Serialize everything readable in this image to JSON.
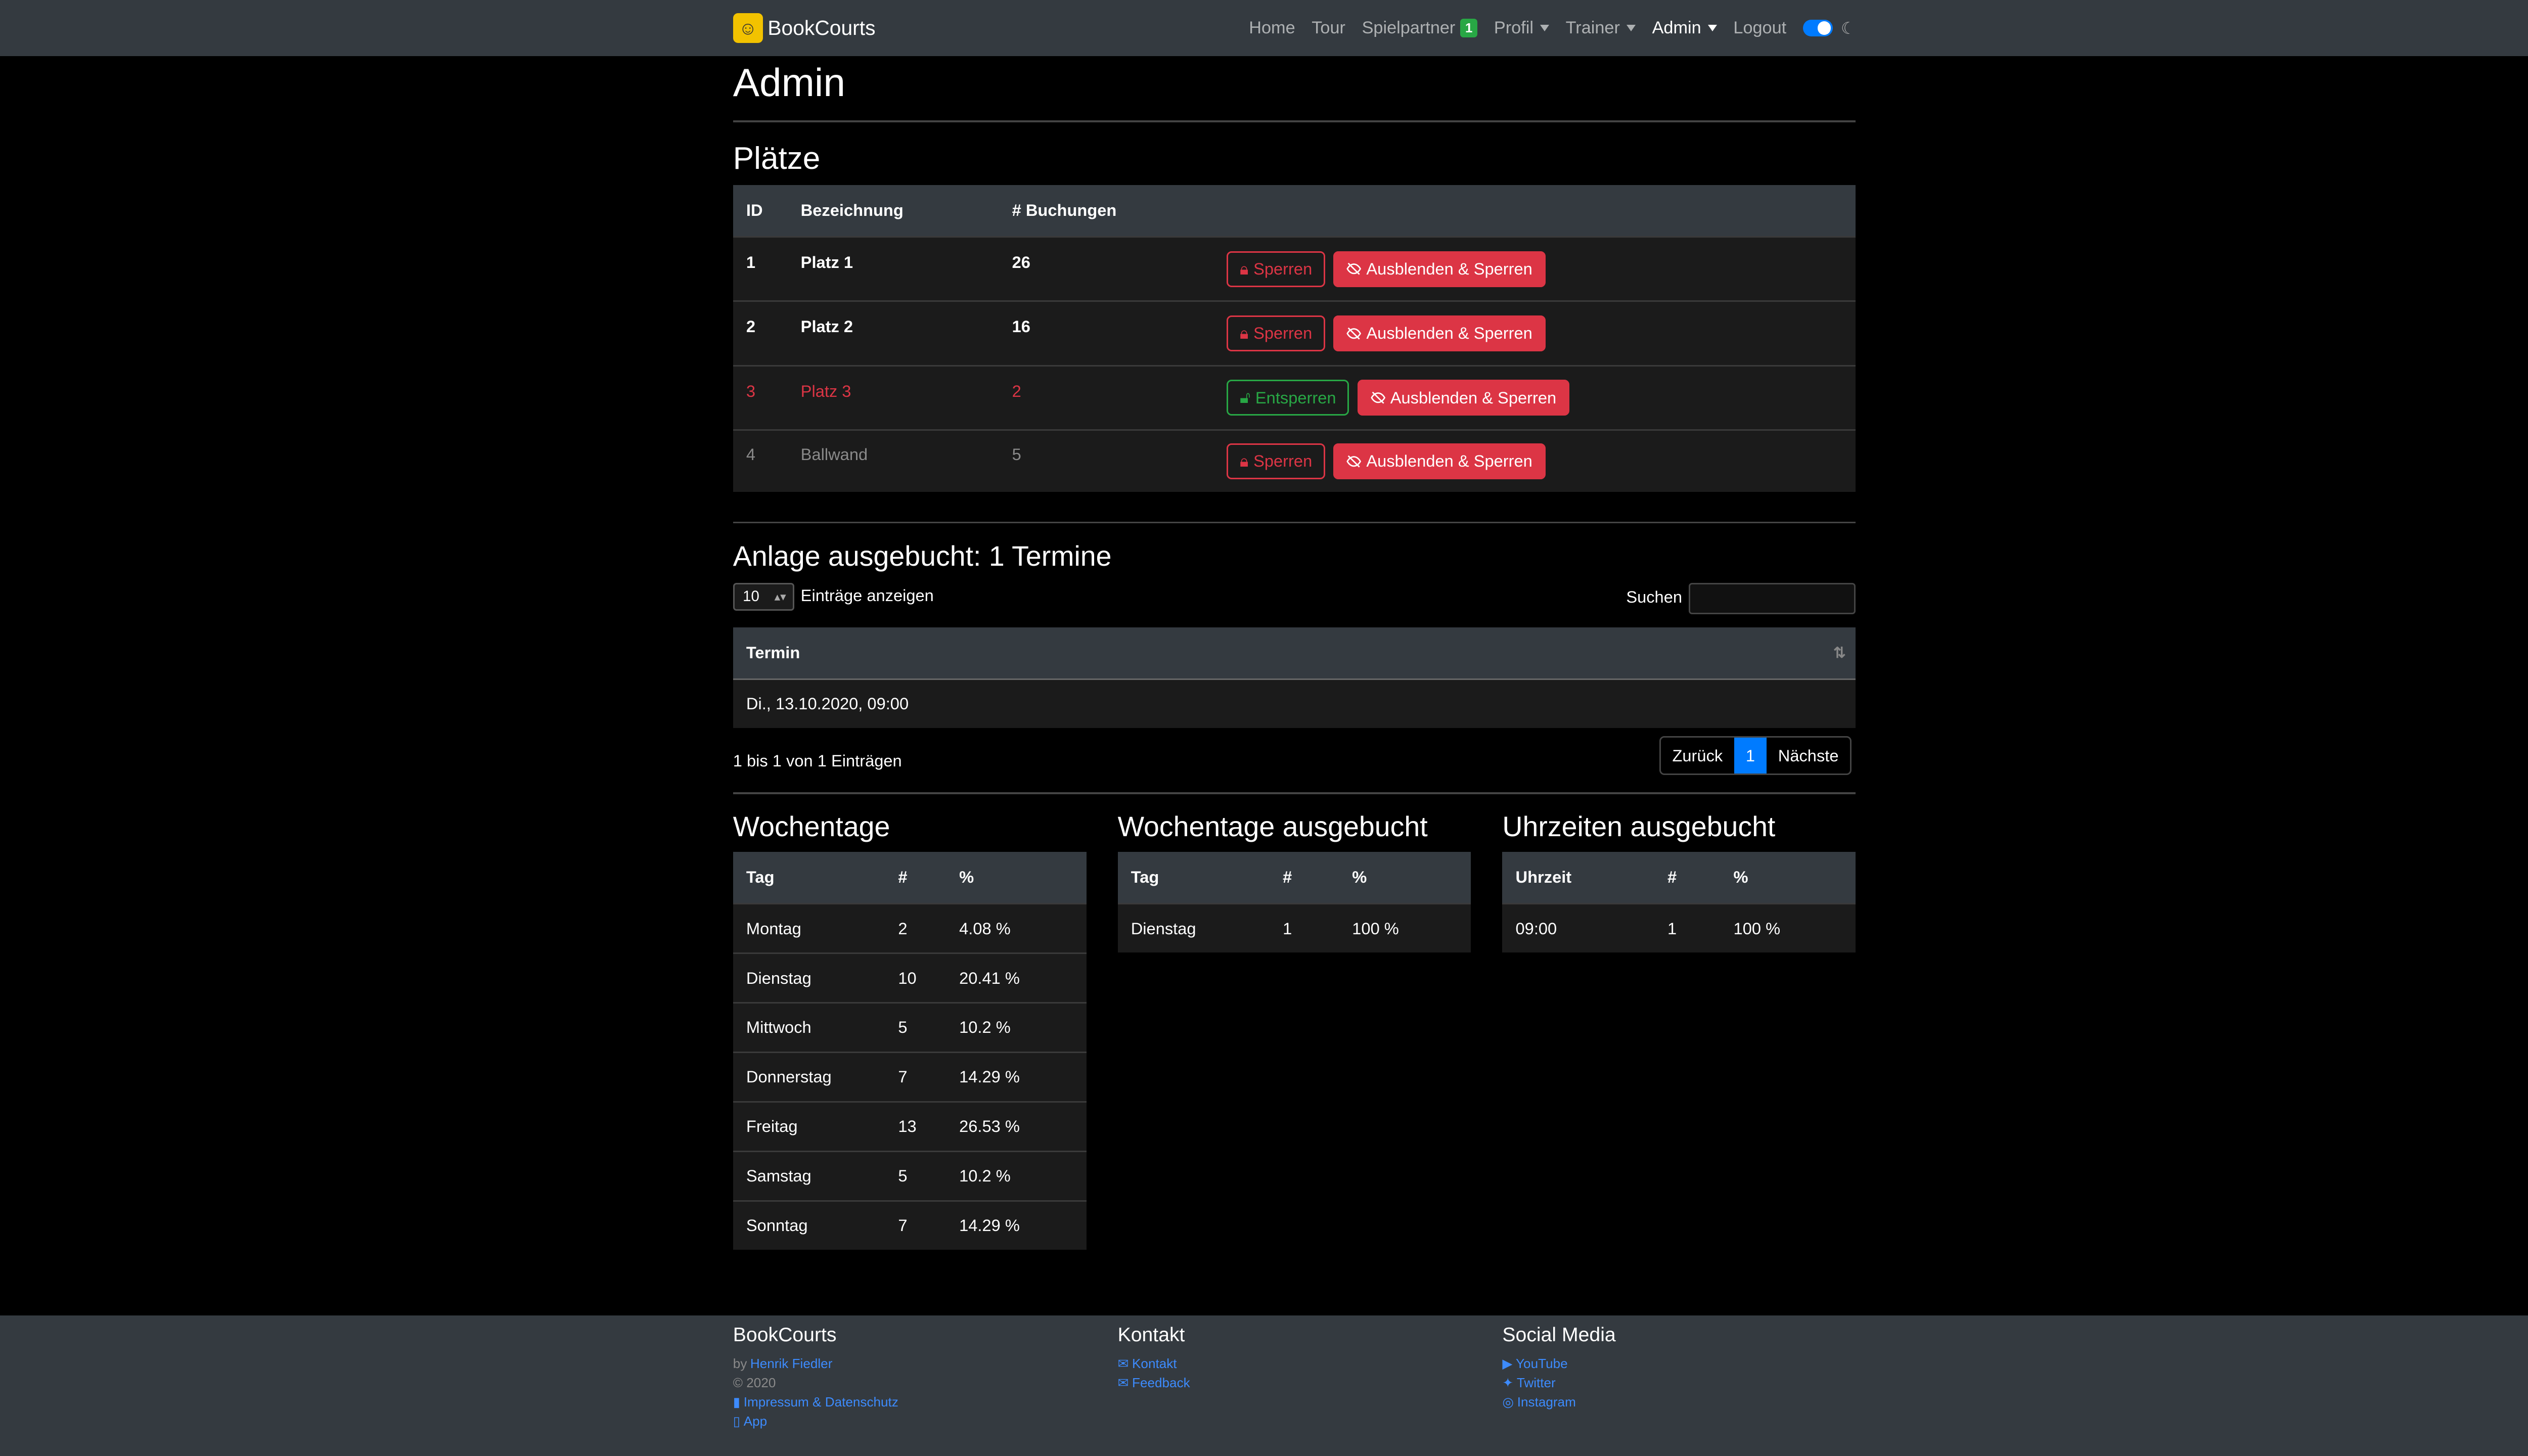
{
  "nav": {
    "brand": "BookCourts",
    "items": [
      {
        "label": "Home"
      },
      {
        "label": "Tour"
      },
      {
        "label": "Spielpartner",
        "badge": "1"
      },
      {
        "label": "Profil"
      },
      {
        "label": "Trainer"
      },
      {
        "label": "Admin"
      },
      {
        "label": "Logout"
      }
    ]
  },
  "page_title": "Admin",
  "courts": {
    "heading": "Plätze",
    "headers": {
      "id": "ID",
      "name": "Bezeichnung",
      "bookings": "# Buchungen"
    },
    "rows": [
      {
        "id": "1",
        "name": "Platz 1",
        "bookings": "26",
        "lock_label": "Sperren",
        "hide_label": "Ausblenden & Sperren"
      },
      {
        "id": "2",
        "name": "Platz 2",
        "bookings": "16",
        "lock_label": "Sperren",
        "hide_label": "Ausblenden & Sperren"
      },
      {
        "id": "3",
        "name": "Platz 3",
        "bookings": "2",
        "lock_label": "Entsperren",
        "hide_label": "Ausblenden & Sperren"
      },
      {
        "id": "4",
        "name": "Ballwand",
        "bookings": "5",
        "lock_label": "Sperren",
        "hide_label": "Ausblenden & Sperren"
      }
    ]
  },
  "booked_out": {
    "heading": "Anlage ausgebucht: 1 Termine",
    "length_value": "10",
    "length_label": "Einträge anzeigen",
    "search_label": "Suchen",
    "search_value": "",
    "column": "Termin",
    "rows": [
      "Di., 13.10.2020, 09:00"
    ],
    "info": "1 bis 1 von 1 Einträgen",
    "prev": "Zurück",
    "page": "1",
    "next": "Nächste"
  },
  "weekdays": {
    "heading": "Wochentage",
    "headers": {
      "a": "Tag",
      "b": "#",
      "c": "%"
    },
    "rows": [
      {
        "a": "Montag",
        "b": "2",
        "c": "4.08 %"
      },
      {
        "a": "Dienstag",
        "b": "10",
        "c": "20.41 %"
      },
      {
        "a": "Mittwoch",
        "b": "5",
        "c": "10.2 %"
      },
      {
        "a": "Donnerstag",
        "b": "7",
        "c": "14.29 %"
      },
      {
        "a": "Freitag",
        "b": "13",
        "c": "26.53 %"
      },
      {
        "a": "Samstag",
        "b": "5",
        "c": "10.2 %"
      },
      {
        "a": "Sonntag",
        "b": "7",
        "c": "14.29 %"
      }
    ]
  },
  "weekdays_booked": {
    "heading": "Wochentage ausgebucht",
    "headers": {
      "a": "Tag",
      "b": "#",
      "c": "%"
    },
    "rows": [
      {
        "a": "Dienstag",
        "b": "1",
        "c": "100 %"
      }
    ]
  },
  "hours_booked": {
    "heading": "Uhrzeiten ausgebucht",
    "headers": {
      "a": "Uhrzeit",
      "b": "#",
      "c": "%"
    },
    "rows": [
      {
        "a": "09:00",
        "b": "1",
        "c": "100 %"
      }
    ]
  },
  "footer": {
    "col1_title": "BookCourts",
    "by": "by",
    "author": "Henrik Fiedler",
    "copyright": "© 2020",
    "impressum": "Impressum & Datenschutz",
    "app": "App",
    "col2_title": "Kontakt",
    "kontakt": "Kontakt",
    "feedback": "Feedback",
    "col3_title": "Social Media",
    "youtube": "YouTube",
    "twitter": "Twitter",
    "instagram": "Instagram"
  },
  "colors": {
    "danger": "#dc3545",
    "success": "#28a745",
    "primary": "#007bff",
    "navbar": "#343a40"
  }
}
